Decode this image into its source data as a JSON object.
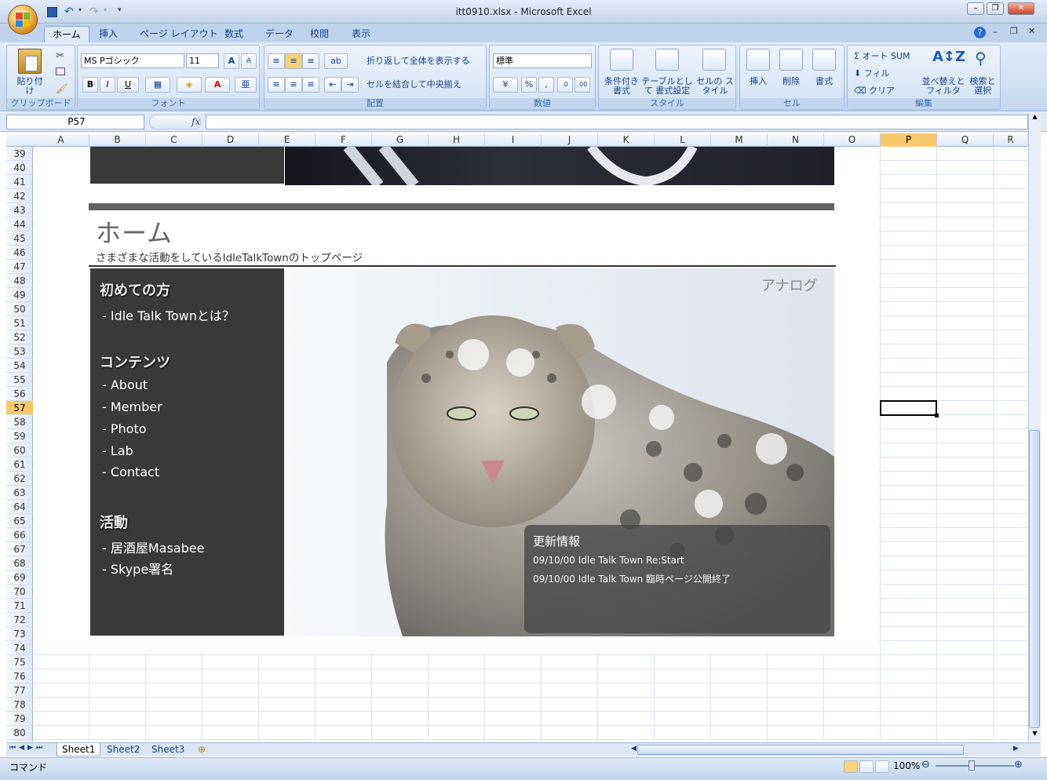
{
  "window": {
    "title": "itt0910.xlsx - Microsoft Excel"
  },
  "ribbon_tabs": [
    "ホーム",
    "挿入",
    "ページ レイアウト",
    "数式",
    "データ",
    "校閲",
    "表示"
  ],
  "clipboard": {
    "paste": "貼り付け",
    "group": "クリップボード"
  },
  "font": {
    "name": "MS Pゴシック",
    "size": "11",
    "group": "フォント",
    "bold": "B",
    "italic": "I",
    "underline": "U"
  },
  "alignment": {
    "wrap": "折り返して全体を表示する",
    "merge": "セルを結合して中央揃え",
    "group": "配置"
  },
  "number": {
    "format": "標準",
    "percent": "%",
    "comma": ",",
    "group": "数値"
  },
  "styles": {
    "conditional": "条件付き 書式",
    "table": "テーブルとして 書式設定",
    "cell": "セルの スタイル",
    "group": "スタイル"
  },
  "cells": {
    "insert": "挿入",
    "delete": "削除",
    "format": "書式",
    "group": "セル"
  },
  "editing": {
    "autosum": "オート SUM",
    "fill": "フィル",
    "clear": "クリア",
    "sort": "並べ替えと フィルタ",
    "find": "検索と 選択",
    "group": "編集"
  },
  "formula_bar": {
    "name_box": "P57",
    "fx": "fx",
    "value": ""
  },
  "columns": [
    "A",
    "B",
    "C",
    "D",
    "E",
    "F",
    "G",
    "H",
    "I",
    "J",
    "K",
    "L",
    "M",
    "N",
    "O",
    "P",
    "Q",
    "R"
  ],
  "selected_column": "P",
  "rows": [
    39,
    40,
    41,
    42,
    43,
    44,
    45,
    46,
    47,
    48,
    49,
    50,
    51,
    52,
    53,
    54,
    55,
    56,
    57,
    58,
    59,
    60,
    61,
    62,
    63,
    64,
    65,
    66,
    67,
    68,
    69,
    70,
    71,
    72,
    73,
    74,
    75,
    76,
    77,
    78,
    79,
    80
  ],
  "selected_row": 57,
  "page": {
    "title": "ホーム",
    "subtitle": "さまざまな活動をしているIdleTalkTownのトップページ",
    "badge": "アナログ",
    "sidebar": {
      "sec1": "初めての方",
      "sec1_items": [
        "- Idle Talk Townとは？"
      ],
      "sec2": "コンテンツ",
      "sec2_items": [
        "- About",
        "- Member",
        "- Photo",
        "- Lab",
        "- Contact"
      ],
      "sec3": "活動",
      "sec3_items": [
        "- 居酒屋Masabee",
        "- Skype署名"
      ]
    },
    "news": {
      "heading": "更新情報",
      "items": [
        "09/10/00 Idle Talk Town Re:Start",
        "09/10/00 Idle Talk Town 臨時ページ公開終了"
      ]
    }
  },
  "sheets": [
    "Sheet1",
    "Sheet2",
    "Sheet3"
  ],
  "active_sheet": "Sheet1",
  "status": {
    "mode": "コマンド",
    "zoom": "100%"
  },
  "colors": {
    "accent": "#f8c86a",
    "ribbon": "#c7d9ef",
    "sidebar": "#3a3a3a"
  }
}
